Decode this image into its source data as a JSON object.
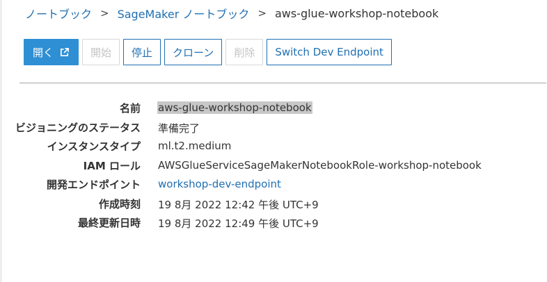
{
  "breadcrumb": {
    "items": [
      "ノートブック",
      "SageMaker ノートブック"
    ],
    "separator": ">",
    "current": "aws-glue-workshop-notebook"
  },
  "toolbar": {
    "open_label": "開く",
    "start_label": "開始",
    "stop_label": "停止",
    "clone_label": "クローン",
    "delete_label": "削除",
    "switch_label": "Switch Dev Endpoint"
  },
  "details": {
    "rows": [
      {
        "label": "名前",
        "value": "aws-glue-workshop-notebook"
      },
      {
        "label": "ビジョニングのステータス",
        "value": "準備完了"
      },
      {
        "label": "インスタンスタイプ",
        "value": "ml.t2.medium"
      },
      {
        "label": "IAM ロール",
        "value": "AWSGlueServiceSageMakerNotebookRole-workshop-notebook"
      },
      {
        "label": "開発エンドポイント",
        "value": "workshop-dev-endpoint"
      },
      {
        "label": "作成時刻",
        "value": "19 8月 2022 12:42 午後 UTC+9"
      },
      {
        "label": "最終更新日時",
        "value": "19 8月 2022 12:49 午後 UTC+9"
      }
    ]
  },
  "colors": {
    "link": "#1f6fb2",
    "primary": "#2e8fd4",
    "disabled": "#c4c4c4",
    "highlight": "#c8c8c8"
  }
}
